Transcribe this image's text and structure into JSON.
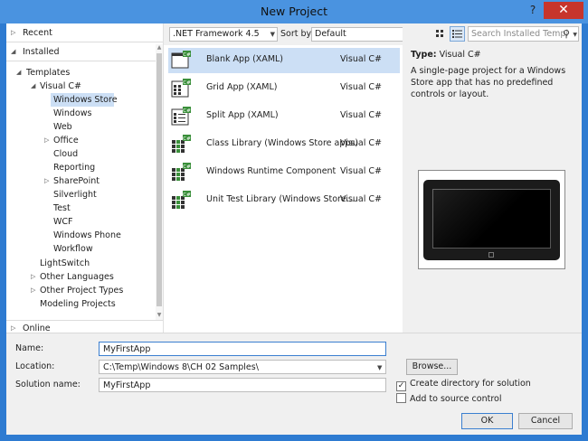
{
  "window": {
    "title": "New Project",
    "help_label": "?",
    "close_label": "✕"
  },
  "tree": {
    "recent_label": "Recent",
    "installed_label": "Installed",
    "templates_label": "Templates",
    "visual_csharp_label": "Visual C#",
    "windows_store_label": "Windows Store",
    "items": [
      {
        "label": "Windows",
        "expandable": false
      },
      {
        "label": "Web",
        "expandable": false
      },
      {
        "label": "Office",
        "expandable": true
      },
      {
        "label": "Cloud",
        "expandable": false
      },
      {
        "label": "Reporting",
        "expandable": false
      },
      {
        "label": "SharePoint",
        "expandable": true
      },
      {
        "label": "Silverlight",
        "expandable": false
      },
      {
        "label": "Test",
        "expandable": false
      },
      {
        "label": "WCF",
        "expandable": false
      },
      {
        "label": "Windows Phone",
        "expandable": false
      },
      {
        "label": "Workflow",
        "expandable": false
      }
    ],
    "lightswitch_label": "LightSwitch",
    "other_languages_label": "Other Languages",
    "other_project_types_label": "Other Project Types",
    "modeling_projects_label": "Modeling Projects",
    "online_label": "Online"
  },
  "toolbar": {
    "framework_value": ".NET Framework 4.5",
    "sort_by_label": "Sort by:",
    "sort_value": "Default",
    "search_placeholder": "Search Installed Templ"
  },
  "templates": [
    {
      "name": "Blank App (XAML)",
      "lang": "Visual C#",
      "selected": true,
      "icon": "blank-app-icon"
    },
    {
      "name": "Grid App (XAML)",
      "lang": "Visual C#",
      "selected": false,
      "icon": "grid-app-icon"
    },
    {
      "name": "Split App (XAML)",
      "lang": "Visual C#",
      "selected": false,
      "icon": "split-app-icon"
    },
    {
      "name": "Class Library (Windows Store apps)",
      "lang": "Visual C#",
      "selected": false,
      "icon": "class-library-icon"
    },
    {
      "name": "Windows Runtime Component",
      "lang": "Visual C#",
      "selected": false,
      "icon": "runtime-component-icon"
    },
    {
      "name": "Unit Test Library (Windows Store...",
      "lang": "Visual C#",
      "selected": false,
      "icon": "unit-test-icon"
    }
  ],
  "details": {
    "type_label": "Type:",
    "type_value": "Visual C#",
    "description": "A single-page project for a Windows Store app that has no predefined controls or layout."
  },
  "form": {
    "name_label": "Name:",
    "name_value": "MyFirstApp",
    "location_label": "Location:",
    "location_value": "C:\\Temp\\Windows 8\\CH 02 Samples\\",
    "solution_name_label": "Solution name:",
    "solution_name_value": "MyFirstApp",
    "browse_label": "Browse...",
    "create_directory_label": "Create directory for solution",
    "create_directory_checked": true,
    "add_source_control_label": "Add to source control",
    "add_source_control_checked": false,
    "ok_label": "OK",
    "cancel_label": "Cancel"
  },
  "colors": {
    "accent": "#2e7bd1",
    "selection": "#ccdff5",
    "close": "#c7352c"
  }
}
